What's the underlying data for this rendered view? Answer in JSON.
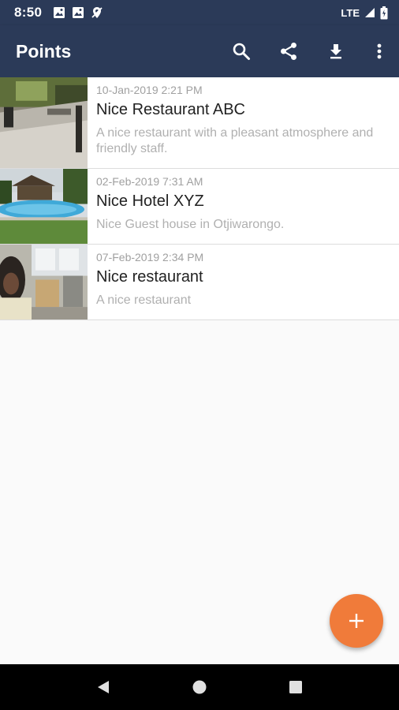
{
  "status_bar": {
    "time": "8:50",
    "network": "LTE",
    "icons_left": [
      "photo-notification-icon",
      "photo-notification-icon",
      "location-off-icon"
    ],
    "icons_right": [
      "signal-icon",
      "battery-icon"
    ]
  },
  "app_bar": {
    "title": "Points",
    "actions": [
      "search-icon",
      "share-icon",
      "download-icon",
      "more-vert-icon"
    ]
  },
  "points": [
    {
      "date": "10-Jan-2019 2:21 PM",
      "title": "Nice Restaurant ABC",
      "description": "A nice restaurant with a pleasant atmosphere and friendly staff."
    },
    {
      "date": "02-Feb-2019 7:31 AM",
      "title": "Nice Hotel XYZ",
      "description": "Nice Guest house in Otjiwarongo."
    },
    {
      "date": "07-Feb-2019 2:34 PM",
      "title": "Nice restaurant",
      "description": "A nice restaurant"
    }
  ],
  "fab": {
    "icon": "add-icon",
    "color": "#f07b3a"
  },
  "colors": {
    "primary": "#2b3a58",
    "accent": "#f07b3a"
  },
  "nav_bar": {
    "buttons": [
      "back-icon",
      "home-icon",
      "recents-icon"
    ]
  }
}
